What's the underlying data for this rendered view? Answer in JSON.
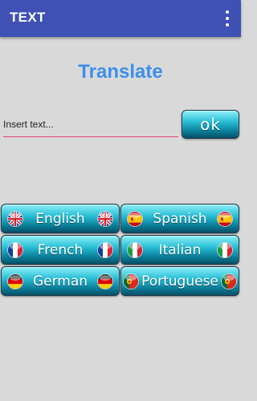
{
  "appbar": {
    "title": "TEXT",
    "overflow_icon": "more-vert-icon",
    "color": "#3f51b5"
  },
  "main": {
    "heading": "Translate",
    "heading_color": "#3d8fea",
    "input": {
      "value": "",
      "placeholder": "Insert text...",
      "underline_color": "#e0457a"
    },
    "ok_label": "ok"
  },
  "languages": [
    {
      "label": "English",
      "flag": "uk-flag-icon"
    },
    {
      "label": "Spanish",
      "flag": "spain-flag-icon"
    },
    {
      "label": "French",
      "flag": "france-flag-icon"
    },
    {
      "label": "Italian",
      "flag": "italy-flag-icon"
    },
    {
      "label": "German",
      "flag": "germany-flag-icon"
    },
    {
      "label": "Portuguese",
      "flag": "portugal-flag-icon"
    }
  ]
}
